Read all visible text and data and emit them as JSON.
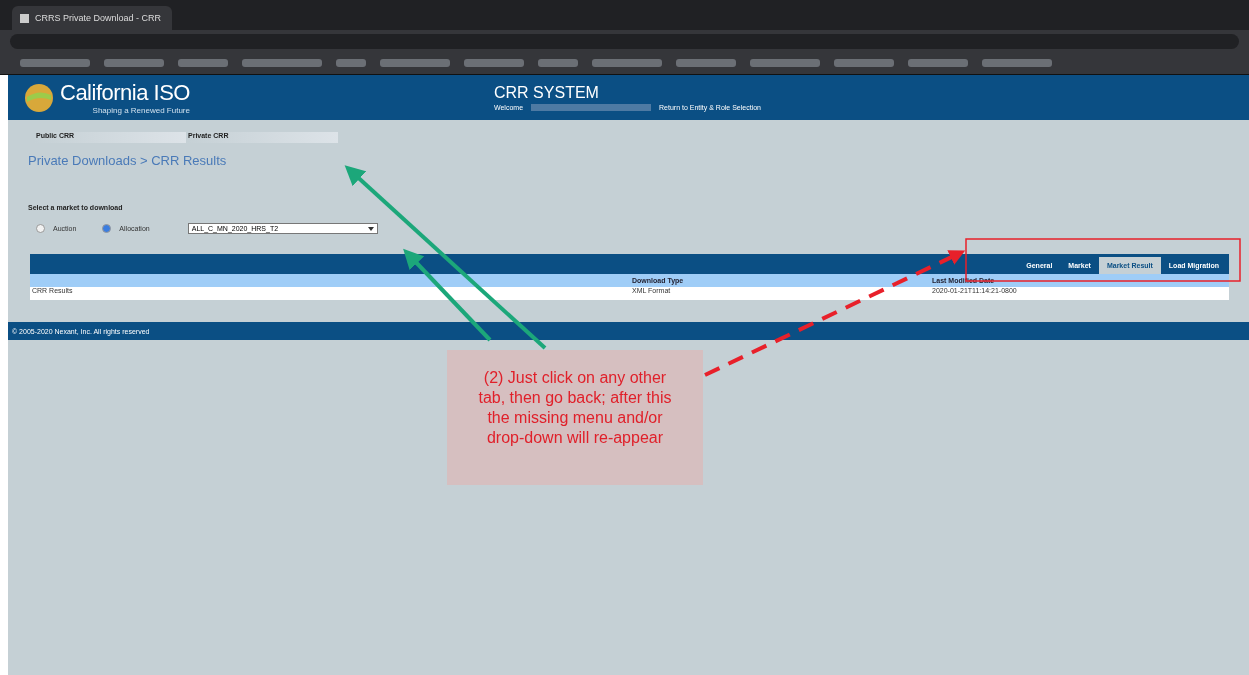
{
  "browser": {
    "tab_title": "CRRS Private Download - CRR"
  },
  "header": {
    "logo_text": "California ISO",
    "tagline": "Shaping a Renewed Future",
    "system_title": "CRR SYSTEM",
    "welcome_label": "Welcome",
    "return_link": "Return to Entity & Role Selection"
  },
  "nav": [
    {
      "label": "Public CRR"
    },
    {
      "label": "Private CRR"
    }
  ],
  "breadcrumb": "Private Downloads > CRR Results",
  "market_select": {
    "label": "Select a market to download",
    "options": [
      {
        "label": "Auction",
        "selected": false
      },
      {
        "label": "Allocation",
        "selected": true
      }
    ],
    "dropdown_value": "ALL_C_MN_2020_HRS_T2"
  },
  "tabs": [
    {
      "label": "General",
      "selected": false
    },
    {
      "label": "Market",
      "selected": false
    },
    {
      "label": "Market Result",
      "selected": true
    },
    {
      "label": "Load Migration",
      "selected": false
    }
  ],
  "table": {
    "columns": [
      "",
      "Download Type",
      "Last Modified Date"
    ],
    "rows": [
      [
        "CRR Results",
        "XML Format",
        "2020-01-21T11:14:21-0800"
      ]
    ]
  },
  "footer": "© 2005-2020 Nexant, Inc. All rights reserved",
  "annotation": {
    "text": "(2) Just click on any other tab, then go back; after this the missing menu and/or drop-down will re-appear"
  }
}
